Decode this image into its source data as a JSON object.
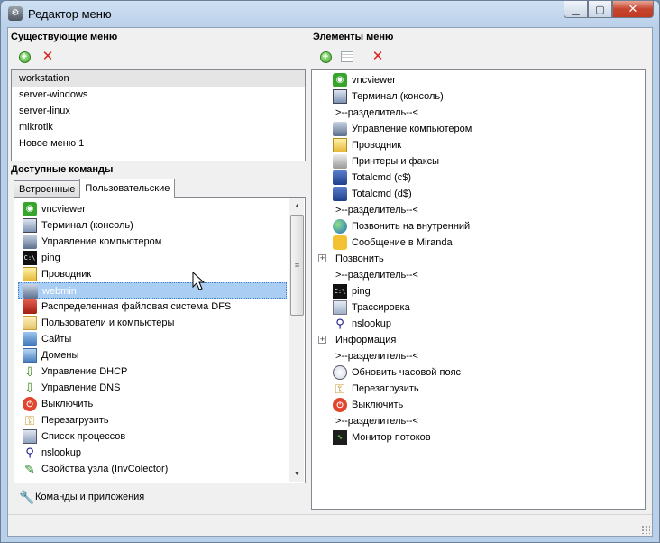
{
  "window": {
    "title": "Редактор меню",
    "caption": {
      "minimize": "▁",
      "maximize": "▢",
      "close": "✕"
    }
  },
  "existing_menus": {
    "title": "Существующие меню",
    "items": [
      "workstation",
      "server-windows",
      "server-linux",
      "mikrotik",
      "Новое меню 1"
    ],
    "selected_index": 0
  },
  "commands": {
    "title": "Доступные команды",
    "tabs": [
      "Встроенные",
      "Пользовательские"
    ],
    "active_tab": 1,
    "items": [
      {
        "label": "vncviewer",
        "icon": "eye-icon"
      },
      {
        "label": "Терминал (консоль)",
        "icon": "terminal-icon"
      },
      {
        "label": "Управление компьютером",
        "icon": "computer-management-icon"
      },
      {
        "label": "ping",
        "icon": "cmd-icon"
      },
      {
        "label": "Проводник",
        "icon": "explorer-icon"
      },
      {
        "label": "webmin",
        "icon": "webmin-icon"
      },
      {
        "label": "Распределенная файловая система DFS",
        "icon": "dfs-icon"
      },
      {
        "label": "Пользователи и компьютеры",
        "icon": "users-icon"
      },
      {
        "label": "Сайты",
        "icon": "sites-icon"
      },
      {
        "label": "Домены",
        "icon": "domains-icon"
      },
      {
        "label": "Управление DHCP",
        "icon": "dhcp-icon"
      },
      {
        "label": "Управление DNS",
        "icon": "dns-icon"
      },
      {
        "label": "Выключить",
        "icon": "power-icon"
      },
      {
        "label": "Перезагрузить",
        "icon": "key-icon"
      },
      {
        "label": "Список процессов",
        "icon": "process-list-icon"
      },
      {
        "label": "nslookup",
        "icon": "network-icon"
      },
      {
        "label": "Свойства узла (InvColector)",
        "icon": "inventory-icon"
      }
    ],
    "highlighted_index": 5,
    "footer_link": "Команды и приложения"
  },
  "menu_elements": {
    "title": "Элементы меню",
    "items": [
      {
        "label": "vncviewer",
        "kind": "item",
        "icon": "eye-icon"
      },
      {
        "label": "Терминал (консоль)",
        "kind": "item",
        "icon": "terminal-icon"
      },
      {
        "label": ">--разделитель--<",
        "kind": "separator"
      },
      {
        "label": "Управление компьютером",
        "kind": "item",
        "icon": "computer-management-icon"
      },
      {
        "label": "Проводник",
        "kind": "item",
        "icon": "explorer-icon"
      },
      {
        "label": "Принтеры и факсы",
        "kind": "item",
        "icon": "printer-icon"
      },
      {
        "label": "Totalcmd (c$)",
        "kind": "item",
        "icon": "floppy-icon"
      },
      {
        "label": "Totalcmd (d$)",
        "kind": "item",
        "icon": "floppy-icon"
      },
      {
        "label": ">--разделитель--<",
        "kind": "separator"
      },
      {
        "label": "Позвонить на внутренний",
        "kind": "item",
        "icon": "globe-icon"
      },
      {
        "label": "Сообщение в Miranda",
        "kind": "item",
        "icon": "message-icon"
      },
      {
        "label": "Позвонить",
        "kind": "group"
      },
      {
        "label": ">--разделитель--<",
        "kind": "separator"
      },
      {
        "label": "ping",
        "kind": "item",
        "icon": "cmd-icon"
      },
      {
        "label": "Трассировка",
        "kind": "item",
        "icon": "trace-icon"
      },
      {
        "label": "nslookup",
        "kind": "item",
        "icon": "network-icon"
      },
      {
        "label": "Информация",
        "kind": "group"
      },
      {
        "label": ">--разделитель--<",
        "kind": "separator"
      },
      {
        "label": "Обновить часовой пояс",
        "kind": "item",
        "icon": "clock-icon"
      },
      {
        "label": "Перезагрузить",
        "kind": "item",
        "icon": "key-icon"
      },
      {
        "label": "Выключить",
        "kind": "item",
        "icon": "power-icon"
      },
      {
        "label": ">--разделитель--<",
        "kind": "separator"
      },
      {
        "label": "Монитор потоков",
        "kind": "item",
        "icon": "monitor-icon"
      }
    ]
  },
  "colors": {
    "highlight": "#a9cdf3",
    "delete": "#d8241c",
    "add": "#3ca32a"
  }
}
